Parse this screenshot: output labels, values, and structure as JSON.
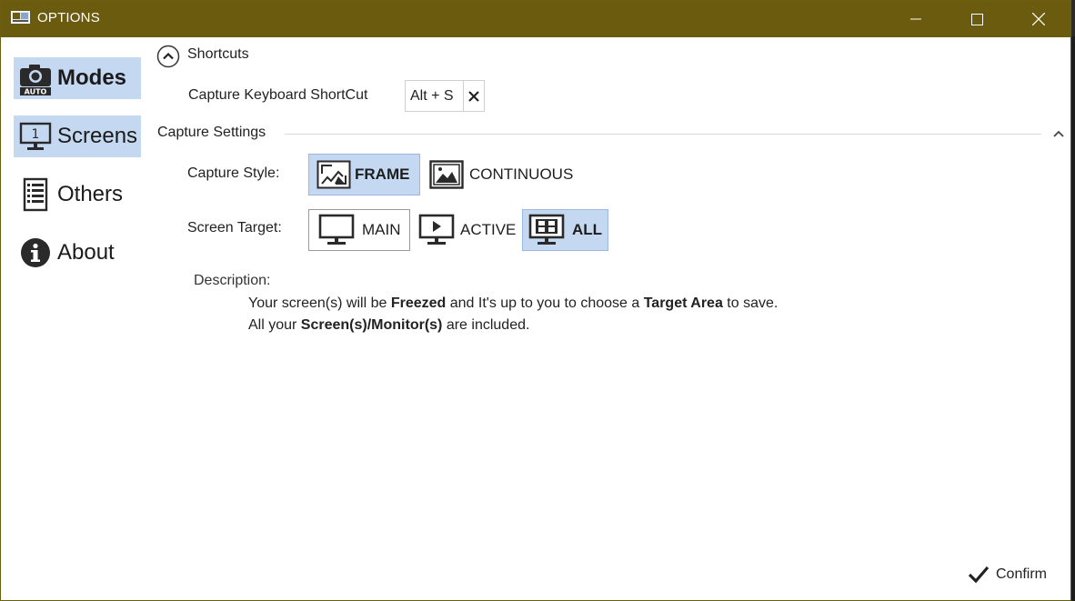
{
  "window": {
    "title": "OPTIONS"
  },
  "titlebar_buttons": {
    "minimize": "minimize",
    "maximize": "maximize",
    "close": "close"
  },
  "sidebar": {
    "items": [
      {
        "label": "Modes",
        "icon": "camera-auto-icon",
        "selected": true,
        "badge": "AUTO"
      },
      {
        "label": "Screens",
        "icon": "monitor-1-icon",
        "selected": true
      },
      {
        "label": "Others",
        "icon": "list-icon",
        "selected": false
      },
      {
        "label": "About",
        "icon": "info-icon",
        "selected": false
      }
    ]
  },
  "shortcuts": {
    "title": "Shortcuts",
    "capture_label": "Capture Keyboard ShortCut",
    "capture_value": "Alt + S"
  },
  "capture_settings": {
    "title": "Capture Settings",
    "style_label": "Capture Style:",
    "style_options": [
      {
        "label": "FRAME",
        "selected": true
      },
      {
        "label": "CONTINUOUS",
        "selected": false
      }
    ],
    "target_label": "Screen Target:",
    "target_options": [
      {
        "label": "MAIN",
        "selected": false
      },
      {
        "label": "ACTIVE",
        "selected": false
      },
      {
        "label": "ALL",
        "selected": true
      }
    ]
  },
  "description": {
    "title": "Description:",
    "line1": {
      "p1": "Your screen(s) will be ",
      "b1": "Freezed",
      "p2": " and It's up to you to choose a ",
      "b2": "Target Area",
      "p3": " to save."
    },
    "line2": {
      "p1": "All your ",
      "b1": "Screen(s)/Monitor(s)",
      "p2": " are included."
    }
  },
  "footer": {
    "confirm_label": "Confirm"
  },
  "colors": {
    "titlebar": "#6b5b0e",
    "selection": "#c5d8f2",
    "selection_border": "#9db7df"
  }
}
